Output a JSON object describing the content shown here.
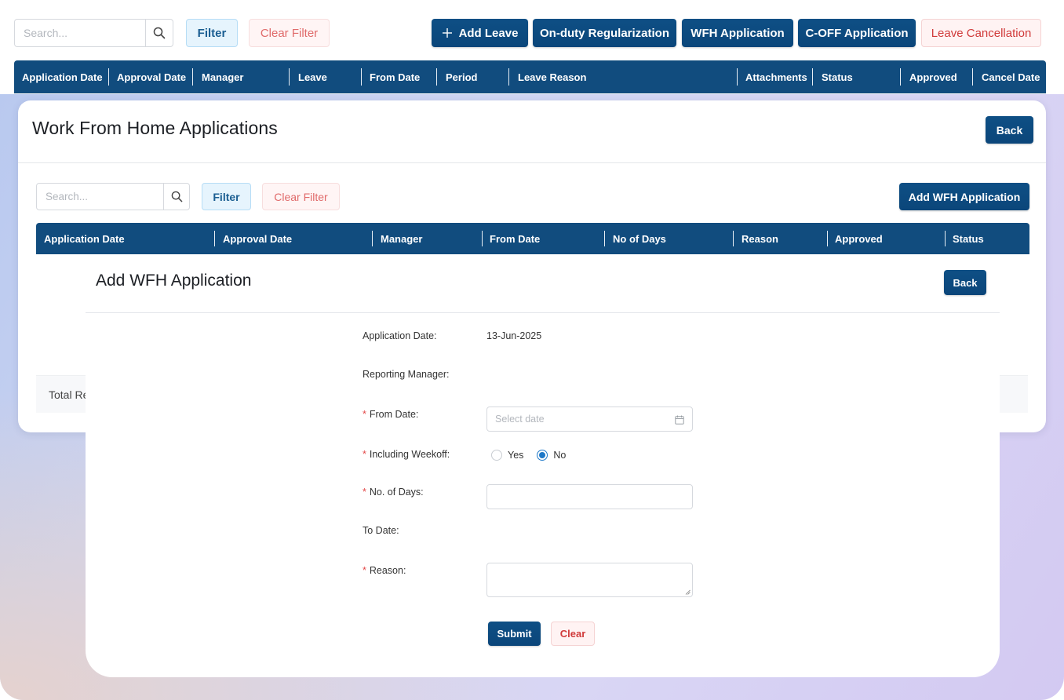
{
  "top_bar": {
    "search_placeholder": "Search...",
    "filter_label": "Filter",
    "clear_filter_label": "Clear Filter",
    "add_leave_label": "Add Leave",
    "add_leave_icon": "plus-icon",
    "onduty_label": "On-duty Regularization",
    "wfh_label": "WFH Application",
    "coff_label": "C-OFF Application",
    "leave_cancel_label": "Leave Cancellation"
  },
  "leave_table": {
    "columns": [
      "Application Date",
      "Approval Date",
      "Manager",
      "Leave",
      "From Date",
      "Period",
      "Leave Reason",
      "Attachments",
      "Status",
      "Approved",
      "Cancel Date"
    ]
  },
  "wfh_panel": {
    "title": "Work From Home Applications",
    "back_label": "Back",
    "search_placeholder": "Search...",
    "filter_label": "Filter",
    "clear_filter_label": "Clear Filter",
    "add_label": "Add WFH Application",
    "columns": [
      "Application Date",
      "Approval Date",
      "Manager",
      "From Date",
      "No of Days",
      "Reason",
      "Approved",
      "Status"
    ],
    "total_label": "Total Re"
  },
  "add_wfh": {
    "title": "Add WFH Application",
    "back_label": "Back",
    "application_date_label": "Application Date:",
    "application_date_value": "13-Jun-2025",
    "reporting_manager_label": "Reporting Manager:",
    "from_date_label": "From Date:",
    "from_date_placeholder": "Select date",
    "weekoff_label": "Including Weekoff:",
    "weekoff_yes": "Yes",
    "weekoff_no": "No",
    "no_of_days_label": "No. of Days:",
    "to_date_label": "To Date:",
    "reason_label": "Reason:",
    "submit_label": "Submit",
    "clear_label": "Clear",
    "required_mark": "*"
  },
  "colors": {
    "primary": "#114c7e",
    "danger": "#d03a3a",
    "accent_radio": "#1e78c8"
  }
}
